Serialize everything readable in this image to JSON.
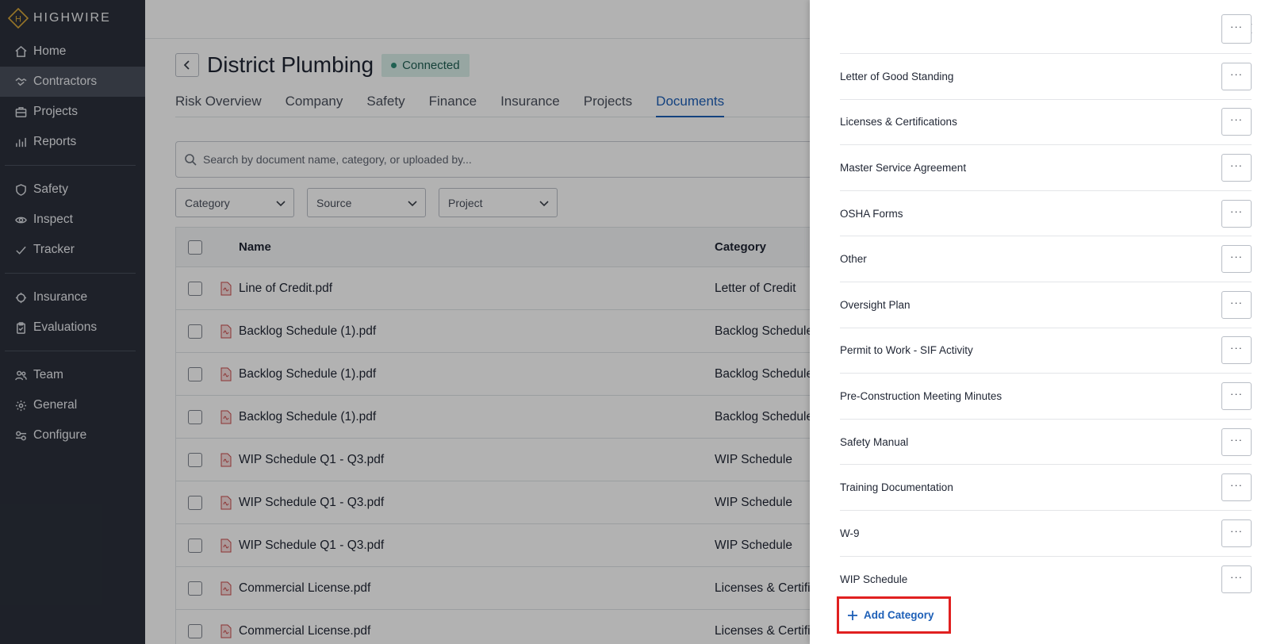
{
  "app": {
    "brand": "HIGHWIRE"
  },
  "sidebar": {
    "groups": [
      [
        {
          "label": "Home",
          "icon": "home-icon"
        },
        {
          "label": "Contractors",
          "icon": "handshake-icon",
          "active": true
        },
        {
          "label": "Projects",
          "icon": "briefcase-icon"
        },
        {
          "label": "Reports",
          "icon": "bar-chart-icon"
        }
      ],
      [
        {
          "label": "Safety",
          "icon": "shield-icon"
        },
        {
          "label": "Inspect",
          "icon": "eye-icon"
        },
        {
          "label": "Tracker",
          "icon": "checkmark-icon"
        }
      ],
      [
        {
          "label": "Insurance",
          "icon": "umbrella-icon"
        },
        {
          "label": "Evaluations",
          "icon": "clipboard-icon"
        }
      ],
      [
        {
          "label": "Team",
          "icon": "users-icon"
        },
        {
          "label": "General",
          "icon": "gear-icon"
        },
        {
          "label": "Configure",
          "icon": "sliders-icon"
        }
      ]
    ]
  },
  "header": {
    "title": "District Plumbing",
    "status": "Connected",
    "status_color": "#2e8b76"
  },
  "tabs": [
    "Risk Overview",
    "Company",
    "Safety",
    "Finance",
    "Insurance",
    "Projects",
    "Documents"
  ],
  "active_tab": "Documents",
  "search": {
    "placeholder": "Search by document name, category, or uploaded by..."
  },
  "filters": [
    "Category",
    "Source",
    "Project"
  ],
  "table": {
    "columns": [
      "Name",
      "Category"
    ],
    "rows": [
      {
        "name": "Line of Credit.pdf",
        "category": "Letter of Credit"
      },
      {
        "name": "Backlog Schedule (1).pdf",
        "category": "Backlog Schedule"
      },
      {
        "name": "Backlog Schedule (1).pdf",
        "category": "Backlog Schedule"
      },
      {
        "name": "Backlog Schedule (1).pdf",
        "category": "Backlog Schedule"
      },
      {
        "name": "WIP Schedule Q1 - Q3.pdf",
        "category": "WIP Schedule"
      },
      {
        "name": "WIP Schedule Q1 - Q3.pdf",
        "category": "WIP Schedule"
      },
      {
        "name": "WIP Schedule Q1 - Q3.pdf",
        "category": "WIP Schedule"
      },
      {
        "name": "Commercial License.pdf",
        "category": "Licenses & Certific"
      },
      {
        "name": "Commercial License.pdf",
        "category": "Licenses & Certific"
      }
    ]
  },
  "drawer": {
    "categories": [
      "Letter of Good Standing",
      "Licenses & Certifications",
      "Master Service Agreement",
      "OSHA Forms",
      "Other",
      "Oversight Plan",
      "Permit to Work - SIF Activity",
      "Pre-Construction Meeting Minutes",
      "Safety Manual",
      "Training Documentation",
      "W-9",
      "WIP Schedule"
    ],
    "more_label": "···",
    "add_label": "Add Category",
    "accent": "#1d5fb7",
    "highlight": "#e02020"
  }
}
